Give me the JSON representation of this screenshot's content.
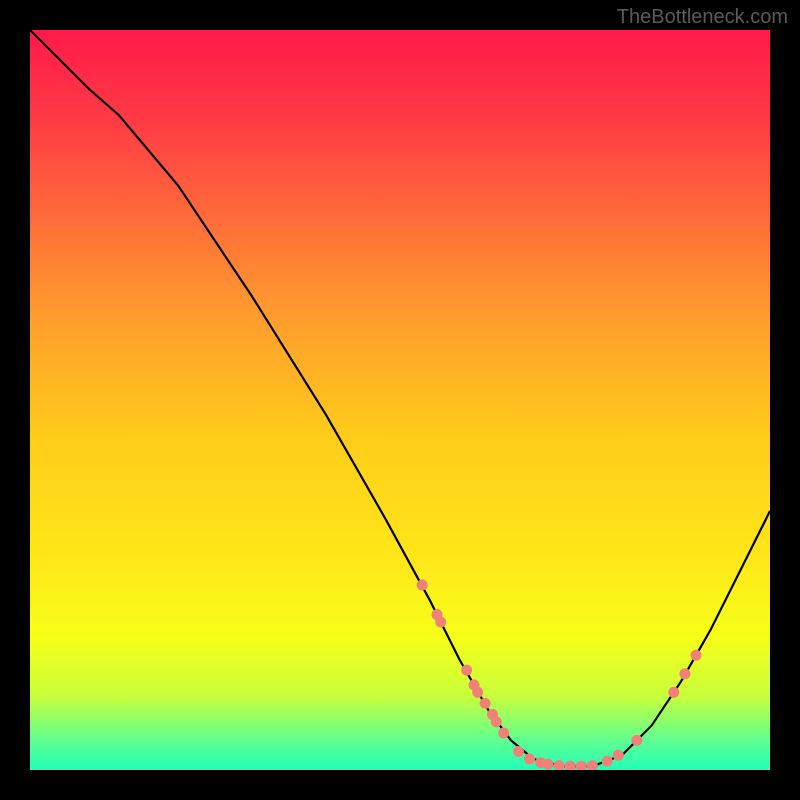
{
  "watermark": "TheBottleneck.com",
  "chart_data": {
    "type": "line",
    "title": "",
    "xlabel": "",
    "ylabel": "",
    "xlim": [
      0,
      100
    ],
    "ylim": [
      0,
      100
    ],
    "curve": [
      {
        "x": 0,
        "y": 100
      },
      {
        "x": 3,
        "y": 97
      },
      {
        "x": 8,
        "y": 92
      },
      {
        "x": 12,
        "y": 88.5
      },
      {
        "x": 20,
        "y": 79
      },
      {
        "x": 30,
        "y": 64
      },
      {
        "x": 40,
        "y": 48
      },
      {
        "x": 48,
        "y": 34
      },
      {
        "x": 54,
        "y": 23
      },
      {
        "x": 58,
        "y": 15
      },
      {
        "x": 62,
        "y": 8
      },
      {
        "x": 65,
        "y": 4
      },
      {
        "x": 68,
        "y": 1.5
      },
      {
        "x": 72,
        "y": 0.5
      },
      {
        "x": 76,
        "y": 0.5
      },
      {
        "x": 80,
        "y": 2
      },
      {
        "x": 84,
        "y": 6
      },
      {
        "x": 88,
        "y": 12
      },
      {
        "x": 92,
        "y": 19
      },
      {
        "x": 96,
        "y": 27
      },
      {
        "x": 100,
        "y": 35
      }
    ],
    "markers_left": [
      {
        "x": 53,
        "y": 25
      },
      {
        "x": 55,
        "y": 21
      },
      {
        "x": 55.5,
        "y": 20
      },
      {
        "x": 59,
        "y": 13.5
      },
      {
        "x": 60,
        "y": 11.5
      },
      {
        "x": 60.5,
        "y": 10.5
      },
      {
        "x": 61.5,
        "y": 9
      },
      {
        "x": 62.5,
        "y": 7.5
      },
      {
        "x": 63,
        "y": 6.5
      },
      {
        "x": 64,
        "y": 5
      }
    ],
    "markers_bottom": [
      {
        "x": 66,
        "y": 2.5
      },
      {
        "x": 67.5,
        "y": 1.5
      },
      {
        "x": 69,
        "y": 1
      },
      {
        "x": 70,
        "y": 0.8
      },
      {
        "x": 71.5,
        "y": 0.6
      },
      {
        "x": 73,
        "y": 0.5
      },
      {
        "x": 74.5,
        "y": 0.5
      },
      {
        "x": 76,
        "y": 0.6
      },
      {
        "x": 78,
        "y": 1.2
      },
      {
        "x": 79.5,
        "y": 2
      }
    ],
    "markers_right": [
      {
        "x": 82,
        "y": 4
      },
      {
        "x": 87,
        "y": 10.5
      },
      {
        "x": 88.5,
        "y": 13
      },
      {
        "x": 90,
        "y": 15.5
      }
    ],
    "marker_color": "#f08078",
    "curve_color": "#000000"
  }
}
